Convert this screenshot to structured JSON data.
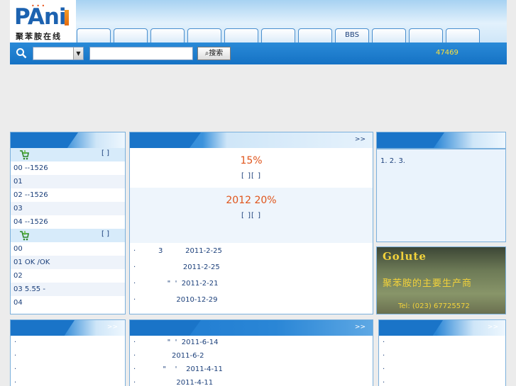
{
  "logo": {
    "brand": "PAni",
    "tagline": "聚苯胺在线"
  },
  "nav": {
    "tabs": [
      "",
      "",
      "",
      "",
      "",
      "",
      "",
      "BBS",
      "",
      "",
      ""
    ]
  },
  "search": {
    "category": "",
    "query": "",
    "button_label": "搜索",
    "visitor_count": "47469"
  },
  "left_panel": {
    "more": "",
    "groups": [
      {
        "bracket": "[ ]",
        "rows": [
          "00    --1526",
          "01",
          "02    --1526",
          "03",
          "04    --1526"
        ]
      },
      {
        "bracket": "[ ]",
        "rows": [
          "00",
          "01   OK   /OK",
          "02",
          "03 5.55   -",
          "04"
        ]
      }
    ]
  },
  "center_panel": {
    "more": ">>",
    "headlines": [
      {
        "title": "15%",
        "links": "[        ][        ]"
      },
      {
        "title": "2012  20%",
        "links": "[        ][        ]"
      }
    ],
    "list": [
      "·          3          2011-2-25",
      "·                     2011-2-25",
      "·              \"  '  2011-2-21",
      "·                  2010-12-29"
    ]
  },
  "intro": {
    "text": "1. 2. 3."
  },
  "ad": {
    "brand": "Golute",
    "slogan": "聚苯胺的主要生产商",
    "phone": "Tel: (023) 67725572"
  },
  "bottom_panels": [
    {
      "more": ">>",
      "rows": [
        "·",
        "·",
        "·",
        "·"
      ]
    },
    {
      "more": ">>",
      "rows": [
        "·              \"  '  2011-6-14",
        "·                2011-6-2",
        "·            \"    '    2011-4-11",
        "·                  2011-4-11"
      ]
    },
    {
      "more": ">>",
      "rows": [
        "·",
        "·",
        "·",
        "·"
      ]
    }
  ],
  "colors": {
    "header_blue": "#1572c4",
    "accent_orange": "#e0541a",
    "link_blue": "#1b3f7a",
    "ad_gold": "#f2d23b"
  }
}
